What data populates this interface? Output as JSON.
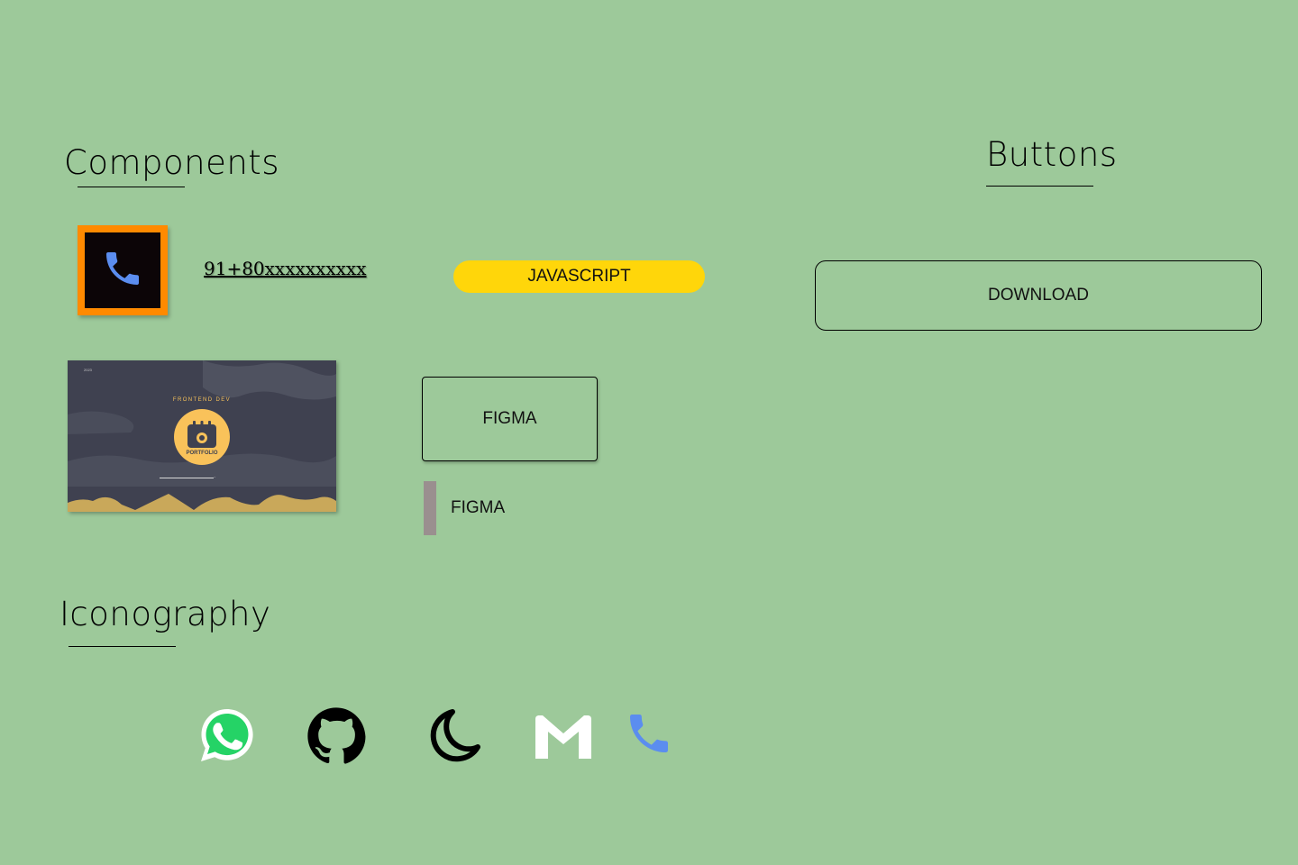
{
  "headings": {
    "components": "Components",
    "buttons": "Buttons",
    "iconography": "Iconography"
  },
  "contact": {
    "phone_number": "91+80xxxxxxxxxx",
    "phone_icon": "phone-icon"
  },
  "buttons": {
    "javascript_label": "JAVASCRIPT",
    "download_label": "DOWNLOAD",
    "figma_outlined_label": "FIGMA",
    "figma_tab_label": "FIGMA"
  },
  "portfolio_preview": {
    "year": "2023",
    "kicker": "FRONTEND DEV",
    "badge_label": "PORTFOLIO"
  },
  "icons": [
    "whatsapp-icon",
    "github-icon",
    "moon-icon",
    "gmail-icon",
    "phone-icon"
  ],
  "colors": {
    "background": "#9dc99a",
    "pill_yellow": "#ffd60a",
    "tile_orange": "#ff8a00",
    "phone_blue": "#5b8def",
    "whatsapp_green": "#25d366",
    "badge_yellow": "#f9c25a"
  }
}
